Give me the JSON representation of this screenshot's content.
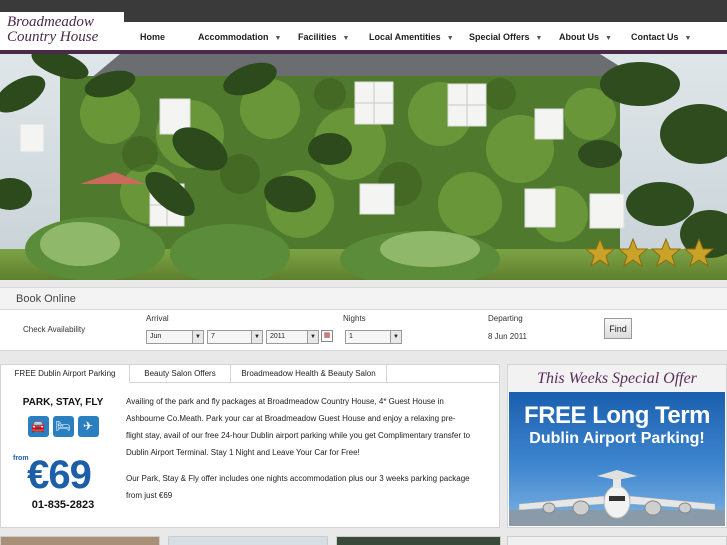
{
  "site": {
    "logo_line1": "Broadmeadow",
    "logo_line2": "Country House"
  },
  "nav": {
    "items": [
      {
        "label": "Home",
        "has_dropdown": false
      },
      {
        "label": "Accommodation",
        "has_dropdown": true
      },
      {
        "label": "Facilities",
        "has_dropdown": true
      },
      {
        "label": "Local Amentities",
        "has_dropdown": true
      },
      {
        "label": "Special Offers",
        "has_dropdown": true
      },
      {
        "label": "About Us",
        "has_dropdown": true
      },
      {
        "label": "Contact Us",
        "has_dropdown": true
      }
    ]
  },
  "hero": {
    "star_rating": 4
  },
  "booking": {
    "title": "Book Online",
    "check_label": "Check Availability",
    "arrival_label": "Arrival",
    "arrival_month": "Jun",
    "arrival_day": "7",
    "arrival_year": "2011",
    "nights_label": "Nights",
    "nights_value": "1",
    "departing_label": "Departing",
    "departing_value": "8 Jun 2011",
    "find_label": "Find"
  },
  "tabs": [
    {
      "label": "FREE Dublin Airport Parking",
      "active": true
    },
    {
      "label": "Beauty Salon Offers",
      "active": false
    },
    {
      "label": "Broadmeadow Health & Beauty Salon",
      "active": false
    }
  ],
  "promo": {
    "title": "PARK, STAY, FLY",
    "from_label": "from",
    "price": "€69",
    "phone": "01-835-2823",
    "icons": [
      "car-icon",
      "bed-icon",
      "plane-icon"
    ]
  },
  "content": {
    "paragraph1": "Availing of the park and fly packages at Broadmeadow Country House, 4* Guest House in Ashbourne Co.Meath. Park your car at Broadmeadow Guest House and enjoy a relaxing pre-flight stay, avail of our free 24-hour Dublin airport parking while you get Complimentary transfer to Dublin Airport Terminal. Stay 1 Night and Leave Your Car for Free!",
    "paragraph2": "Our Park, Stay & Fly offer includes one nights accommodation plus our 3 weeks parking package from just €69"
  },
  "offer": {
    "title": "This Weeks Special Offer",
    "line1": "FREE Long Term",
    "line2": "Dublin Airport Parking!"
  },
  "colors": {
    "accent": "#4a2a4a",
    "promo_blue": "#1c5ea8",
    "star_gold": "#c9a227"
  }
}
